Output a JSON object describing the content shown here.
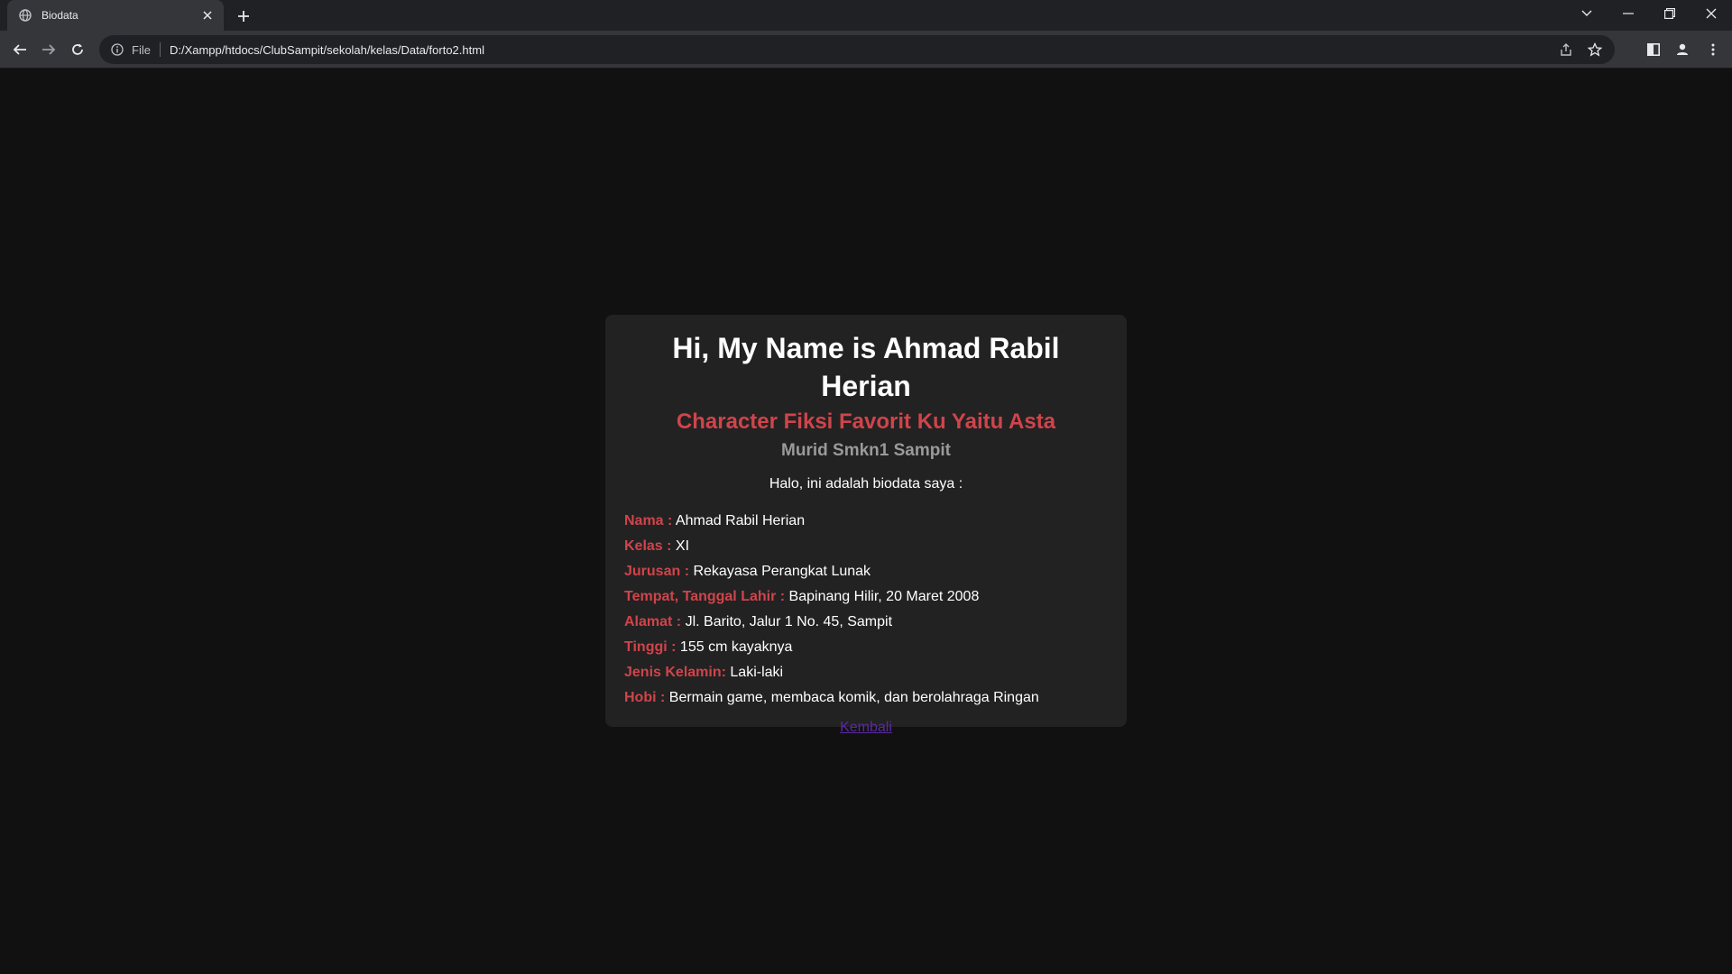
{
  "browser": {
    "tab": {
      "title": "Biodata"
    },
    "address": {
      "scheme_label": "File",
      "url": "D:/Xampp/htdocs/ClubSampit/sekolah/kelas/Data/forto2.html"
    }
  },
  "profile": {
    "heading": "Hi, My Name is Ahmad Rabil Herian",
    "subheading": "Character Fiksi Favorit Ku Yaitu Asta",
    "school": "Murid Smkn1 Sampit",
    "intro": "Halo, ini adalah biodata saya :",
    "fields": [
      {
        "label": "Nama :",
        "value": "Ahmad Rabil Herian"
      },
      {
        "label": "Kelas :",
        "value": "XI"
      },
      {
        "label": "Jurusan :",
        "value": "Rekayasa Perangkat Lunak"
      },
      {
        "label": "Tempat, Tanggal Lahir :",
        "value": "Bapinang Hilir, 20 Maret 2008"
      },
      {
        "label": "Alamat :",
        "value": "Jl. Barito, Jalur 1 No. 45, Sampit"
      },
      {
        "label": "Tinggi :",
        "value": "155 cm kayaknya"
      },
      {
        "label": "Jenis Kelamin:",
        "value": "Laki-laki"
      },
      {
        "label": "Hobi :",
        "value": "Bermain game, membaca komik, dan berolahraga Ringan"
      }
    ],
    "back_link": "Kembali"
  },
  "colors": {
    "page_bg": "#111111",
    "card_bg": "#222222",
    "accent_red": "#d0444b",
    "muted_gray": "#9a9a9a",
    "visited_link": "#5a2aa0"
  }
}
